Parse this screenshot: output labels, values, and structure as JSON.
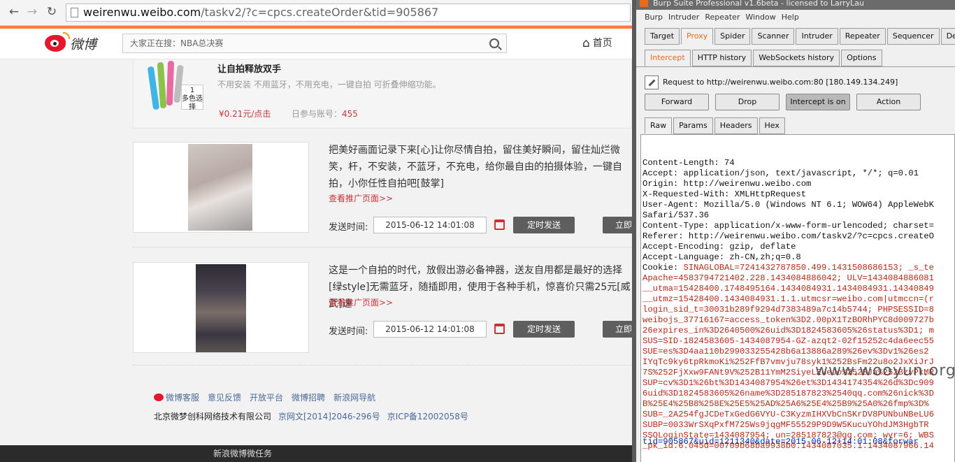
{
  "browser": {
    "url_host": "weirenwu.weibo.com",
    "url_path": "/taskv2/?c=cpcs.createOrder&tid=905867"
  },
  "weibo": {
    "logo_text": "微博",
    "search_placeholder": "大家正在搜：NBA总决赛",
    "home_label": "首页"
  },
  "task0": {
    "title": "让自拍释放双手",
    "desc": "不用安装 不用蓝牙，不用充电，一键自拍 可折叠伸缩功能。",
    "price": "¥0.21元/点击",
    "accounts_label": "日参与账号：",
    "accounts_value": "455",
    "thumb_tag": "多色选择",
    "thumb_num": "1"
  },
  "tasks": [
    {
      "text": "把美好画面记录下来[心]让你尽情自拍，留住美好瞬间，留住灿烂微笑，杆，不安装，不蓝牙，不充电，给你最自由的拍摄体验，一键自拍，小你任性自拍吧[鼓掌]",
      "more": "查看推广页面>>",
      "send_label": "发送时间:",
      "datetime": "2015-06-12 14:01:08",
      "timed_send": "定时发送",
      "send_now": "立即"
    },
    {
      "text": "这是一个自拍的时代，放假出游必备神器，送友自用都是最好的选择[绿style]无需蓝牙，随插即用，使用于各种手机，惊喜价只需25元[威武]速",
      "more": "查看推广页面>>",
      "send_label": "发送时间:",
      "datetime": "2015-06-12 14:01:08",
      "timed_send": "定时发送",
      "send_now": "立即"
    }
  ],
  "footer": {
    "links": [
      "微博客服",
      "意见反馈",
      "开放平台",
      "微博招聘",
      "新浪网导航"
    ],
    "company": "北京微梦创科网络技术有限公司",
    "license1": "京网文[2014]2046-296号",
    "license2": "京ICP备12002058号"
  },
  "bottom_bar": "新浪微博微任务",
  "burp": {
    "title": "Burp Suite Professional v1.6beta - licensed to LarryLau",
    "menu": [
      "Burp",
      "Intruder",
      "Repeater",
      "Window",
      "Help"
    ],
    "tabs": [
      "Target",
      "Proxy",
      "Spider",
      "Scanner",
      "Intruder",
      "Repeater",
      "Sequencer",
      "Decoder"
    ],
    "subtabs": [
      "Intercept",
      "HTTP history",
      "WebSockets history",
      "Options"
    ],
    "request_line": "Request to http://weirenwu.weibo.com:80  [180.149.134.249]",
    "buttons": {
      "forward": "Forward",
      "drop": "Drop",
      "intercept": "Intercept is on",
      "action": "Action"
    },
    "view_tabs": [
      "Raw",
      "Params",
      "Headers",
      "Hex"
    ],
    "lines": [
      {
        "t": "Content-Length: 74",
        "c": "hdr"
      },
      {
        "t": "Accept: application/json, text/javascript, */*; q=0.01",
        "c": "hdr"
      },
      {
        "t": "Origin: http://weirenwu.weibo.com",
        "c": "hdr"
      },
      {
        "t": "X-Requested-With: XMLHttpRequest",
        "c": "hdr"
      },
      {
        "t": "User-Agent: Mozilla/5.0 (Windows NT 6.1; WOW64) AppleWebK",
        "c": "hdr"
      },
      {
        "t": "Safari/537.36",
        "c": "hdr"
      },
      {
        "t": "Content-Type: application/x-www-form-urlencoded; charset=",
        "c": "hdr"
      },
      {
        "t": "Referer: http://weirenwu.weibo.com/taskv2/?c=cpcs.createO",
        "c": "hdr"
      },
      {
        "t": "Accept-Encoding: gzip, deflate",
        "c": "hdr"
      },
      {
        "t": "Accept-Language: zh-CN,zh;q=0.8",
        "c": "hdr"
      },
      {
        "t": "Cookie: SINAGLOBAL=7241432787850.499.1431508686153; _s_te",
        "c": "ckmix"
      },
      {
        "t": "Apache=4583794721402.228.1434084886042; ULV=1434084886081",
        "c": "ckr"
      },
      {
        "t": "__utma=15428400.1748495164.1434084931.1434084931.14340849",
        "c": "ckr"
      },
      {
        "t": "__utmz=15428400.1434084931.1.1.utmcsr=weibo.com|utmccn=(r",
        "c": "ckr"
      },
      {
        "t": "login_sid_t=30031b289f9294d7383489a7c14b5744; PHPSESSID=8",
        "c": "ckr"
      },
      {
        "t": "weibojs_37716167=access_token%3D2.00pX1TzBORhPYC8d009727b",
        "c": "ckr"
      },
      {
        "t": "26expires_in%3D2640500%26uid%3D1824583605%26status%3D1; m",
        "c": "ckr"
      },
      {
        "t": "SUS=SID-1824583605-1434087954-GZ-azqt2-02f15252c4da6eec55",
        "c": "ckr"
      },
      {
        "t": "SUE=es%3D4aa110b299033255428b6a13886a289%26ev%3Dv1%26es2",
        "c": "ckr"
      },
      {
        "t": "IYqTc9ky6tpRkmoKi%252FfB7vmvju78syk1%252BsFm22u8o2JxXiJrJ",
        "c": "ckr"
      },
      {
        "t": "7S%252FjXxw9FANt9V%252B11YmM2SiyeLZueJo%252BJa%252BzvPkMR",
        "c": "ckr"
      },
      {
        "t": "SUP=cv%3D1%26bt%3D1434087954%26et%3D1434174354%26d%3Dc909",
        "c": "ckr"
      },
      {
        "t": "6uid%3D1824583605%26name%3D285187823%2540qq.com%26nick%3D",
        "c": "ckr"
      },
      {
        "t": "B%25E4%25B8%258E%25E5%25AD%25A6%25E4%25B9%25A0%26fmp%3D%",
        "c": "ckr"
      },
      {
        "t": "SUB=_2A254fgJCDeTxGedG6VYU-C3KyzmIHXVbCnSKrDV8PUNbuNBeLU6",
        "c": "ckr"
      },
      {
        "t": "SUBP=0033WrSXqPxfM725Ws9jqgMF55529P9D9W5KucuYOhdJM3HgbTR",
        "c": "ckr"
      },
      {
        "t": "SSOLoginState=1434087954; un=285187823@qq.com; wvr=6; WBS",
        "c": "ckr"
      },
      {
        "t": "_pk_id.6.045d=00709b68ba9938b0.1434087035.1.1434087966.14",
        "c": "ckr"
      }
    ],
    "body": "tid=905867&uid=1211340&date=2015-06-12+14:01:08&forwar",
    "watermark": "www.wooyun.org"
  }
}
